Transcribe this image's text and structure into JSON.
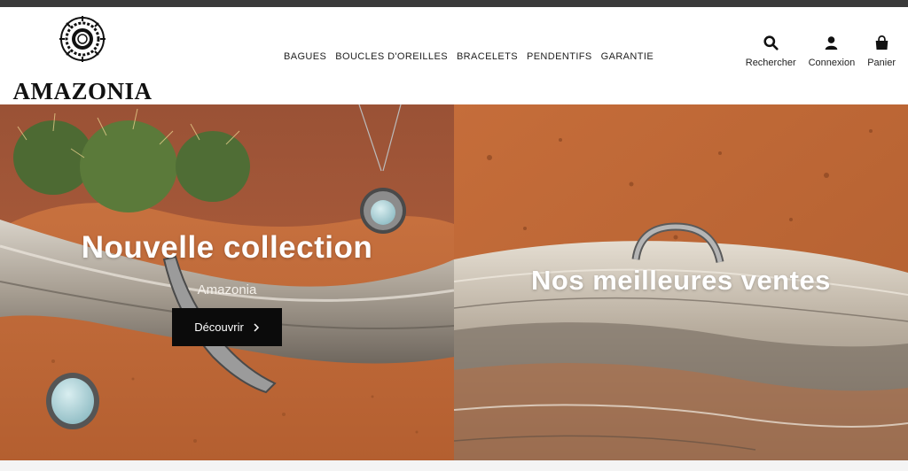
{
  "brand": {
    "name": "AMAZONIA"
  },
  "nav": {
    "items": [
      {
        "label": "BAGUES"
      },
      {
        "label": "BOUCLES D'OREILLES"
      },
      {
        "label": "BRACELETS"
      },
      {
        "label": "PENDENTIFS"
      },
      {
        "label": "GARANTIE"
      }
    ]
  },
  "header_actions": {
    "search": {
      "label": "Rechercher",
      "icon": "search-icon"
    },
    "account": {
      "label": "Connexion",
      "icon": "user-icon"
    },
    "cart": {
      "label": "Panier",
      "icon": "bag-icon"
    }
  },
  "hero_left": {
    "title": "Nouvelle collection",
    "subtitle": "Amazonia",
    "button_label": "Découvrir",
    "button_icon": "chevron-right-icon"
  },
  "hero_right": {
    "title": "Nos meilleures ventes"
  },
  "colors": {
    "top_bar": "#3a3a3a",
    "sand": "#c8733e",
    "cta_bg": "#0b0b0b"
  }
}
